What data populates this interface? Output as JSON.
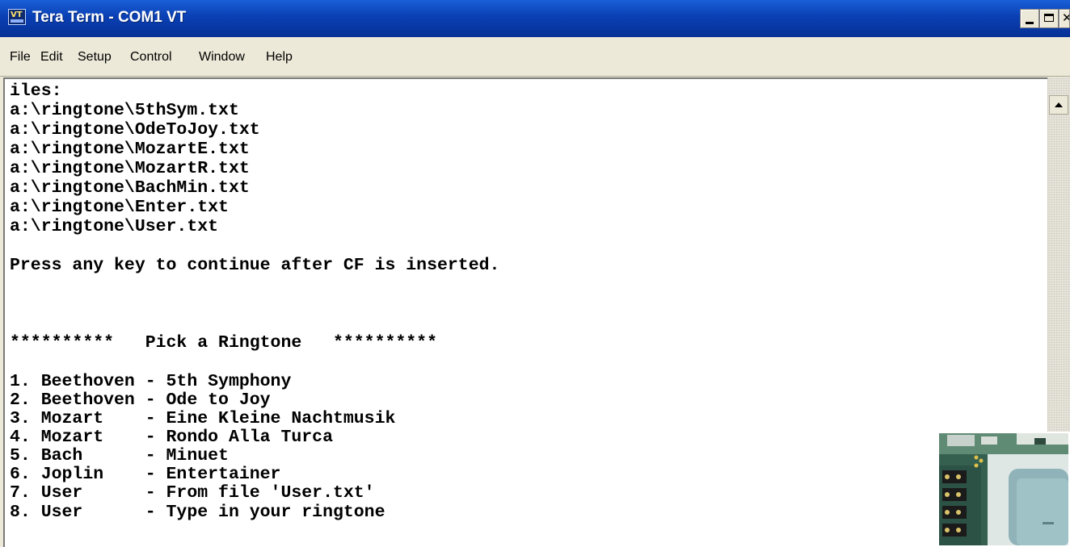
{
  "window": {
    "title": "Tera Term - COM1 VT",
    "icon_label": "VT"
  },
  "menu": [
    "File",
    "Edit",
    "Setup",
    "Control",
    "Window",
    "Help"
  ],
  "terminal": {
    "lines": [
      "iles:",
      "a:\\ringtone\\5thSym.txt",
      "a:\\ringtone\\OdeToJoy.txt",
      "a:\\ringtone\\MozartE.txt",
      "a:\\ringtone\\MozartR.txt",
      "a:\\ringtone\\BachMin.txt",
      "a:\\ringtone\\Enter.txt",
      "a:\\ringtone\\User.txt",
      "",
      "Press any key to continue after CF is inserted.",
      "",
      "",
      "",
      "**********   Pick a Ringtone   **********",
      "",
      "1. Beethoven - 5th Symphony",
      "2. Beethoven - Ode to Joy",
      "3. Mozart    - Eine Kleine Nachtmusik",
      "4. Mozart    - Rondo Alla Turca",
      "5. Bach      - Minuet",
      "6. Joplin    - Entertainer",
      "7. User      - From file 'User.txt'",
      "8. User      - Type in your ringtone"
    ]
  },
  "colors": {
    "titlebar": "#0a3fb4",
    "terminal_bg": "#ffffff",
    "terminal_fg": "#000000",
    "chrome": "#ece9d8"
  }
}
